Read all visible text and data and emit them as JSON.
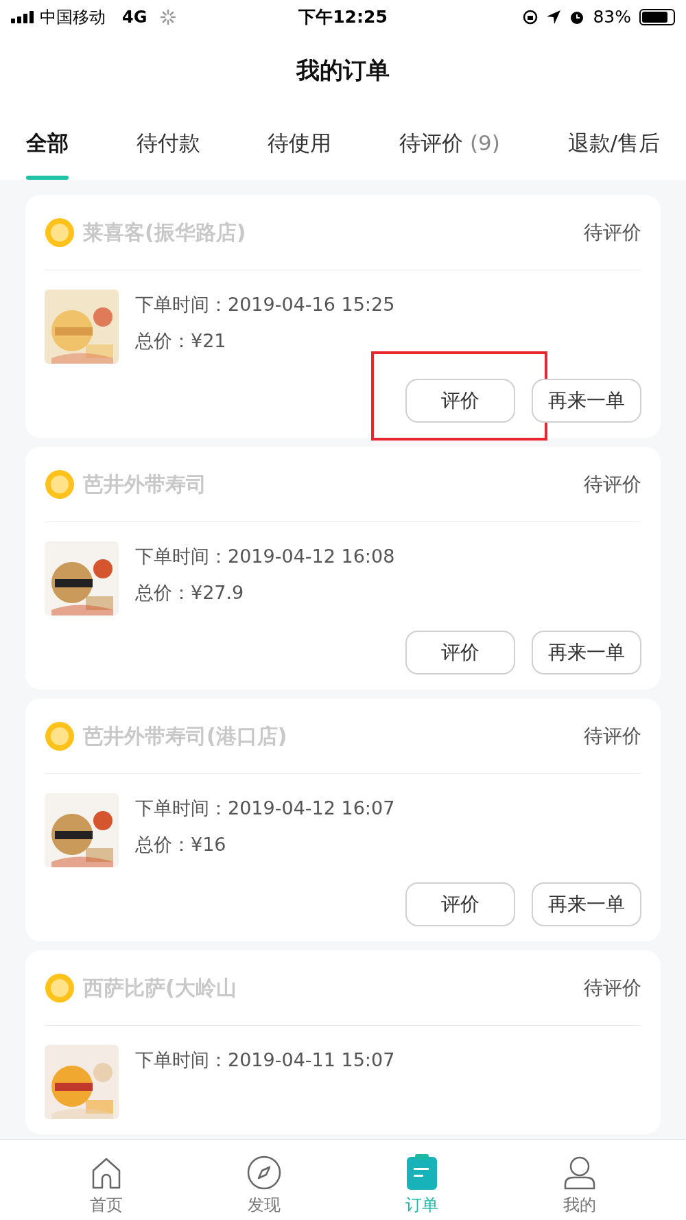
{
  "status_bar": {
    "carrier": "中国移动",
    "network": "4G",
    "time": "下午12:25",
    "battery": "83%"
  },
  "title": "我的订单",
  "tabs": [
    {
      "label": "全部",
      "selected": true
    },
    {
      "label": "待付款",
      "selected": false
    },
    {
      "label": "待使用",
      "selected": false
    },
    {
      "label": "待评价",
      "count": "(9)",
      "selected": false
    },
    {
      "label": "退款/售后",
      "selected": false
    }
  ],
  "orders": [
    {
      "store": "莱喜客(振华路店)",
      "status": "待评价",
      "time": "下单时间：2019-04-16 15:25",
      "price": "总价：¥21",
      "buttons": [
        "评价",
        "再来一单"
      ],
      "highlighted": true
    },
    {
      "store": "芭井外带寿司",
      "status": "待评价",
      "time": "下单时间：2019-04-12 16:08",
      "price": "总价：¥27.9",
      "buttons": [
        "评价",
        "再来一单"
      ],
      "highlighted": false
    },
    {
      "store": "芭井外带寿司(港口店)",
      "status": "待评价",
      "time": "下单时间：2019-04-12 16:07",
      "price": "总价：¥16",
      "buttons": [
        "评价",
        "再来一单"
      ],
      "highlighted": false
    },
    {
      "store": "西萨比萨(大岭山",
      "status": "待评价",
      "time": "下单时间：2019-04-11 15:07",
      "highlighted": false
    }
  ],
  "nav": [
    {
      "label": "首页",
      "selected": false
    },
    {
      "label": "发现",
      "selected": false
    },
    {
      "label": "订单",
      "selected": true
    },
    {
      "label": "我的",
      "selected": false
    }
  ]
}
